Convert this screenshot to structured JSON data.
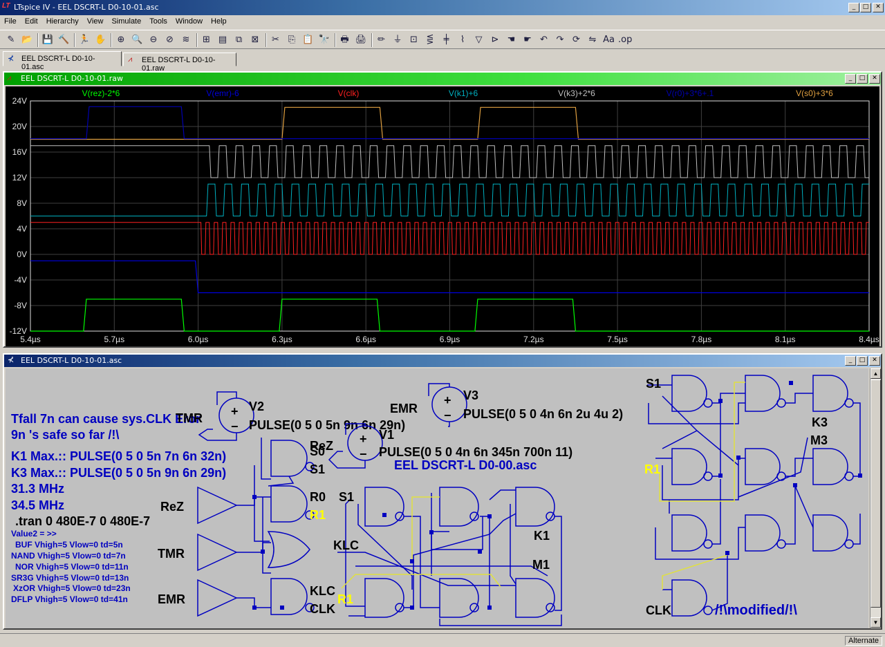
{
  "app": {
    "title": "LTspice IV - EEL DSCRT-L D0-10-01.asc",
    "logo": "LT",
    "window_buttons": [
      "_",
      "□",
      "✕"
    ]
  },
  "menu": [
    "File",
    "Edit",
    "Hierarchy",
    "View",
    "Simulate",
    "Tools",
    "Window",
    "Help"
  ],
  "toolbar": {
    "icons": [
      "new-schematic-icon",
      "open-icon",
      "save-icon",
      "control-panel-icon",
      "run-icon",
      "halt-icon",
      "zoom-in-icon",
      "zoom-area-icon",
      "zoom-out-icon",
      "zoom-fit-icon",
      "autorange-icon",
      "grid-icon",
      "tile-horizontal-icon",
      "cascade-icon",
      "close-window-icon",
      "cut-icon",
      "copy-icon",
      "paste-icon",
      "find-icon",
      "print-setup-icon",
      "print-icon",
      "wire-icon",
      "ground-icon",
      "label-icon",
      "resistor-icon",
      "capacitor-icon",
      "inductor-icon",
      "diode-icon",
      "component-icon",
      "move-icon",
      "drag-icon",
      "undo-icon",
      "redo-icon",
      "rotate-icon",
      "mirror-icon",
      "text-icon",
      "spice-directive-icon"
    ],
    "glyphs": [
      "✎",
      "📂",
      "💾",
      "🔨",
      "🏃",
      "✋",
      "⊕",
      "🔍",
      "⊖",
      "⊘",
      "≋",
      "⊞",
      "▤",
      "⧉",
      "⊠",
      "✂",
      "⎘",
      "📋",
      "🔭",
      "🖶",
      "🖨",
      "✏",
      "⏚",
      "⊡",
      "⋚",
      "╪",
      "⌇",
      "▽",
      "⊳",
      "☚",
      "☛",
      "↶",
      "↷",
      "⟳",
      "⇋",
      "Aa",
      ".op"
    ]
  },
  "tabs": [
    {
      "label": "EEL DSCRT-L D0-10-01.asc",
      "icon": "schematic-icon"
    },
    {
      "label": "EEL DSCRT-L D0-10-01.raw",
      "icon": "waveform-icon"
    }
  ],
  "plot_window": {
    "title": "EEL DSCRT-L D0-10-01.raw",
    "icon": "waveform-icon",
    "traces": [
      {
        "label": "V(rez)-2*6",
        "color": "#00ff00"
      },
      {
        "label": "V(emr)-6",
        "color": "#0000e0"
      },
      {
        "label": "V(clk)",
        "color": "#ff2020"
      },
      {
        "label": "V(k1)+6",
        "color": "#00b0c0"
      },
      {
        "label": "V(k3)+2*6",
        "color": "#c0c0c0"
      },
      {
        "label": "V(r0)+3*6+.1",
        "color": "#0000b0"
      },
      {
        "label": "V(s0)+3*6",
        "color": "#e0a040"
      }
    ]
  },
  "chart_data": {
    "type": "line",
    "xlabel": "",
    "ylabel": "",
    "xlim": [
      5.4,
      8.4
    ],
    "ylim": [
      -12,
      24
    ],
    "x_unit": "µs",
    "grid": true,
    "y_ticks": [
      "24V",
      "20V",
      "16V",
      "12V",
      "8V",
      "4V",
      "0V",
      "-4V",
      "-8V",
      "-12V"
    ],
    "x_ticks": [
      "5.4µs",
      "5.7µs",
      "6.0µs",
      "6.3µs",
      "6.6µs",
      "6.9µs",
      "7.2µs",
      "7.5µs",
      "7.8µs",
      "8.1µs",
      "8.4µs"
    ],
    "series": [
      {
        "name": "V(rez)-2*6",
        "points": [
          [
            5.4,
            -12
          ],
          [
            5.59,
            -12
          ],
          [
            5.6,
            -7
          ],
          [
            5.94,
            -7
          ],
          [
            5.95,
            -12
          ],
          [
            6.29,
            -12
          ],
          [
            6.3,
            -7
          ],
          [
            6.64,
            -7
          ],
          [
            6.65,
            -12
          ],
          [
            6.99,
            -12
          ],
          [
            7.0,
            -7
          ],
          [
            7.34,
            -7
          ],
          [
            7.35,
            -12
          ],
          [
            8.4,
            -12
          ]
        ]
      },
      {
        "name": "V(emr)-6",
        "points": [
          [
            5.4,
            -1
          ],
          [
            5.99,
            -1
          ],
          [
            6.0,
            -6
          ],
          [
            8.4,
            -6
          ]
        ]
      },
      {
        "name": "V(s0)+3*6",
        "points": [
          [
            5.4,
            18
          ],
          [
            6.3,
            18
          ],
          [
            6.31,
            23
          ],
          [
            6.65,
            23
          ],
          [
            6.66,
            18
          ],
          [
            7.0,
            18
          ],
          [
            7.01,
            23
          ],
          [
            7.35,
            23
          ],
          [
            7.36,
            18
          ],
          [
            8.4,
            18
          ]
        ]
      },
      {
        "name": "V(r0)+3*6+.1",
        "points": [
          [
            5.4,
            18.1
          ],
          [
            5.6,
            18.1
          ],
          [
            5.61,
            23.1
          ],
          [
            5.94,
            23.1
          ],
          [
            5.95,
            18.1
          ],
          [
            8.4,
            18.1
          ]
        ]
      }
    ],
    "digital_series": [
      {
        "name": "V(clk)",
        "low": 0,
        "high": 5,
        "start": 6.01,
        "period": 0.0299,
        "before": 5
      },
      {
        "name": "V(k1)+6",
        "low": 6,
        "high": 11,
        "start": 6.03,
        "period": 0.06,
        "before": 6
      },
      {
        "name": "V(k3)+2*6",
        "low": 12,
        "high": 17,
        "start": 6.04,
        "period": 0.06,
        "before": 17
      }
    ]
  },
  "schematic_window": {
    "title": "EEL DSCRT-L D0-10-01.asc",
    "icon": "schematic-icon",
    "comments": [
      "Tfall 7n can cause sys.CLK Eror",
      "9n 's safe so far /!\\",
      "K1 Max.:: PULSE(0 5 0 5n 7n 6n 32n)",
      "K3 Max.:: PULSE(0 5 0 5n 9n 6n 29n)",
      "31.3 MHz",
      "34.5 MHz"
    ],
    "directive": ".tran 0 480E-7 0 480E-7",
    "params": [
      "Value2 = >>",
      "BUF Vhigh=5 Vlow=0 td=5n",
      "NAND Vhigh=5 Vlow=0 td=7n",
      "NOR Vhigh=5 Vlow=0 td=11n",
      "SR3G Vhigh=5 Vlow=0 td=13n",
      "XzOR Vhigh=5 Vlow=0 td=23n",
      "DFLP Vhigh=5 Vlow=0 td=41n"
    ],
    "title_text": "EEL DSCRT-L D0-00.asc",
    "modified_text": "/!\\modified/!\\",
    "sources": [
      {
        "name": "V2",
        "net": "TMR",
        "value": "PULSE(0 5 0 5n 9n 6n 29n)"
      },
      {
        "name": "V3",
        "net": "EMR",
        "value": "PULSE(0 5 0 4n 6n 2u 4u 2)"
      },
      {
        "name": "V1",
        "net": "ReZ",
        "value": "PULSE(0 5 0 4n 6n 345n 700n 11)"
      }
    ],
    "net_labels": [
      "ReZ",
      "TMR",
      "EMR",
      "S0",
      "S1",
      "R0",
      "R1",
      "KLC",
      "CLK",
      "S1",
      "KLC",
      "R1",
      "K1",
      "M1",
      "S1",
      "R1",
      "K3",
      "M3",
      "CLK"
    ]
  },
  "status": {
    "text": "Alternate"
  }
}
